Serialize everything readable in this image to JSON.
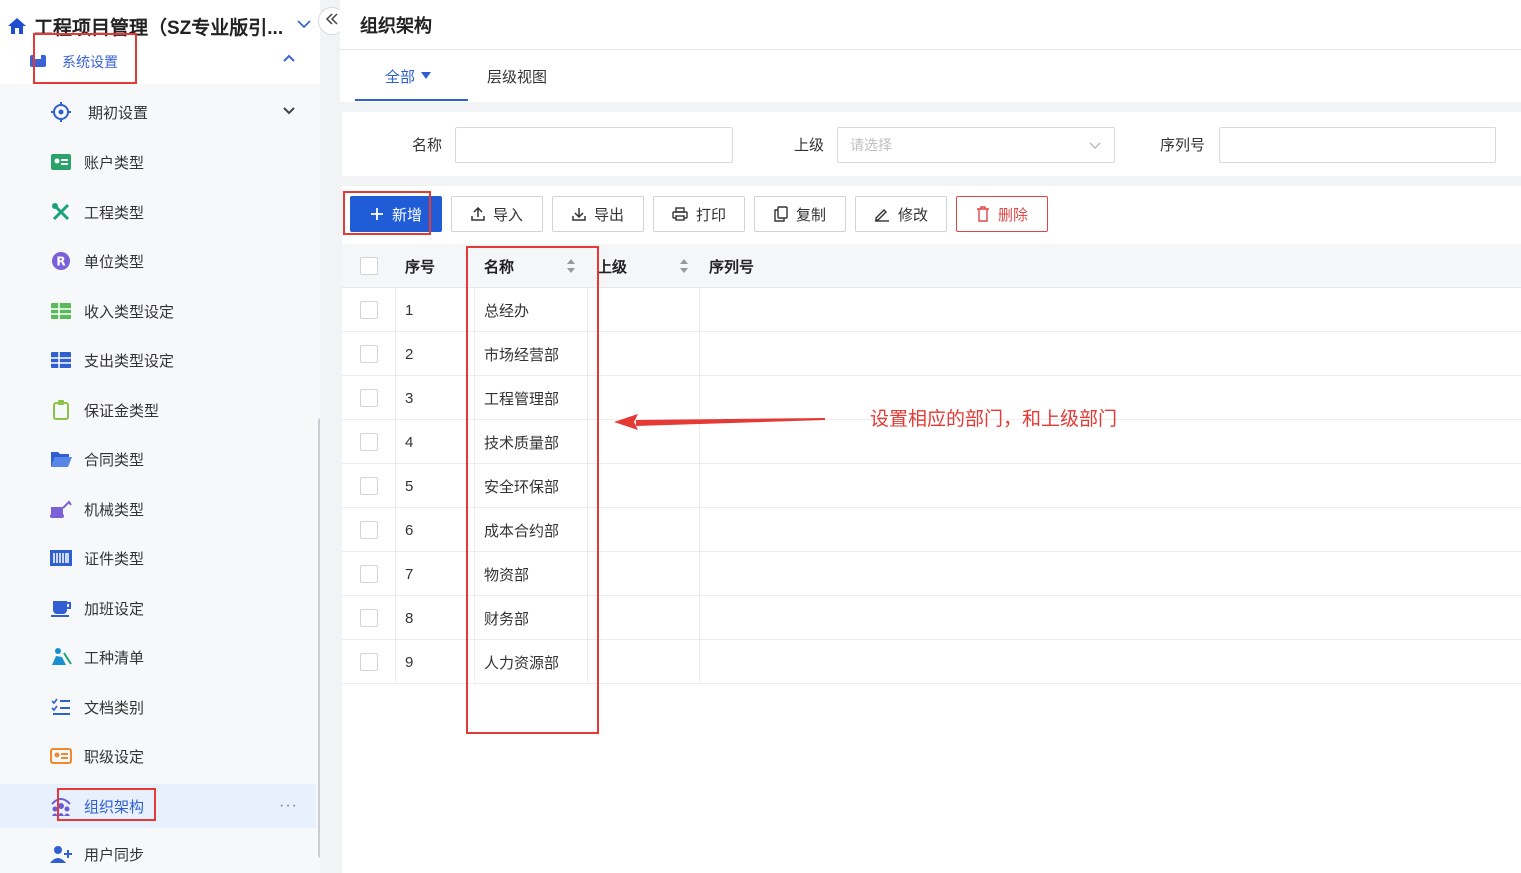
{
  "app": {
    "title": "工程项目管理（SZ专业版引..."
  },
  "sidebar": {
    "group_label": "系统设置",
    "items": [
      {
        "label": "期初设置",
        "icon": "target-icon"
      },
      {
        "label": "账户类型",
        "icon": "id-card-icon"
      },
      {
        "label": "工程类型",
        "icon": "tools-icon"
      },
      {
        "label": "单位类型",
        "icon": "r-badge-icon"
      },
      {
        "label": "收入类型设定",
        "icon": "grid-table-icon"
      },
      {
        "label": "支出类型设定",
        "icon": "grid-table-icon"
      },
      {
        "label": "保证金类型",
        "icon": "clipboard-icon"
      },
      {
        "label": "合同类型",
        "icon": "folder-open-icon"
      },
      {
        "label": "机械类型",
        "icon": "excavator-icon"
      },
      {
        "label": "证件类型",
        "icon": "barcode-icon"
      },
      {
        "label": "加班设定",
        "icon": "coffee-icon"
      },
      {
        "label": "工种清单",
        "icon": "worker-icon"
      },
      {
        "label": "文档类别",
        "icon": "checklist-icon"
      },
      {
        "label": "职级设定",
        "icon": "profile-card-icon"
      },
      {
        "label": "组织架构",
        "icon": "org-icon"
      },
      {
        "label": "用户同步",
        "icon": "user-add-icon"
      }
    ],
    "more_glyph": "···"
  },
  "page": {
    "title": "组织架构"
  },
  "tabs": [
    {
      "label": "全部"
    },
    {
      "label": "层级视图"
    }
  ],
  "filters": {
    "name_label": "名称",
    "parent_label": "上级",
    "parent_placeholder": "请选择",
    "seq_label": "序列号"
  },
  "toolbar": {
    "add": "新增",
    "import": "导入",
    "export": "导出",
    "print": "打印",
    "copy": "复制",
    "edit": "修改",
    "delete": "删除"
  },
  "table": {
    "columns": [
      "序号",
      "名称",
      "上级",
      "序列号"
    ],
    "rows": [
      {
        "no": "1",
        "name": "总经办",
        "parent": "",
        "seq": ""
      },
      {
        "no": "2",
        "name": "市场经营部",
        "parent": "",
        "seq": ""
      },
      {
        "no": "3",
        "name": "工程管理部",
        "parent": "",
        "seq": ""
      },
      {
        "no": "4",
        "name": "技术质量部",
        "parent": "",
        "seq": ""
      },
      {
        "no": "5",
        "name": "安全环保部",
        "parent": "",
        "seq": ""
      },
      {
        "no": "6",
        "name": "成本合约部",
        "parent": "",
        "seq": ""
      },
      {
        "no": "7",
        "name": "物资部",
        "parent": "",
        "seq": ""
      },
      {
        "no": "8",
        "name": "财务部",
        "parent": "",
        "seq": ""
      },
      {
        "no": "9",
        "name": "人力资源部",
        "parent": "",
        "seq": ""
      }
    ]
  },
  "annotation": {
    "text": "设置相应的部门，和上级部门",
    "color": "#e53935"
  },
  "colors": {
    "accent": "#1f5cd6",
    "danger": "#e04646",
    "active_bg": "#e8f0fd"
  }
}
